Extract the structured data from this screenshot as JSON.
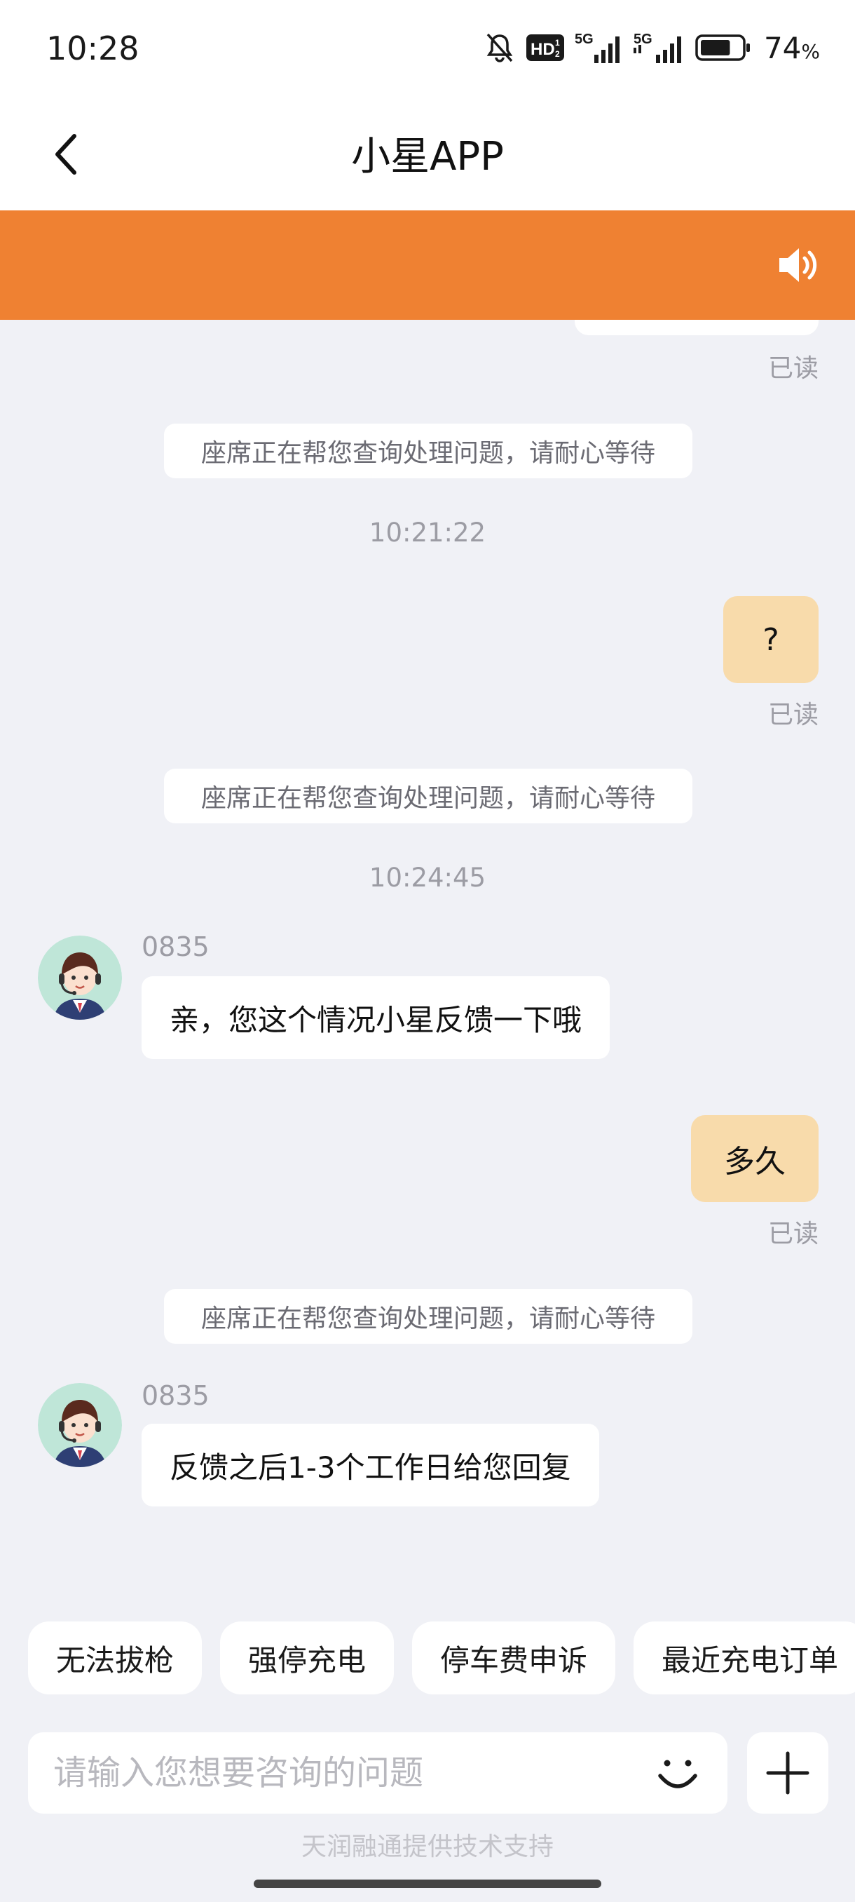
{
  "status_bar": {
    "time": "10:28",
    "hd_badge": "HD",
    "network_1": "5G",
    "network_2": "5G",
    "battery_percent": "74",
    "battery_unit": "%",
    "battery_level": 0.74
  },
  "header": {
    "title": "小星APP"
  },
  "chat": {
    "read_label": "已读",
    "notice_text": "座席正在帮您查询处理问题，请耐心等待",
    "timestamps": [
      "10:21:22",
      "10:24:45"
    ],
    "my_messages": [
      "?",
      "多久"
    ],
    "agent": {
      "id": "0835",
      "messages": [
        "亲，您这个情况小星反馈一下哦",
        "反馈之后1-3个工作日给您回复"
      ]
    }
  },
  "quick_replies": [
    "无法拔枪",
    "强停充电",
    "停车费申诉",
    "最近充电订单"
  ],
  "input": {
    "placeholder": "请输入您想要咨询的问题"
  },
  "footer": {
    "powered_by": "天润融通提供技术支持"
  },
  "colors": {
    "banner": "#ef8132",
    "my_bubble": "#f8dbab",
    "background": "#f0f1f6"
  }
}
